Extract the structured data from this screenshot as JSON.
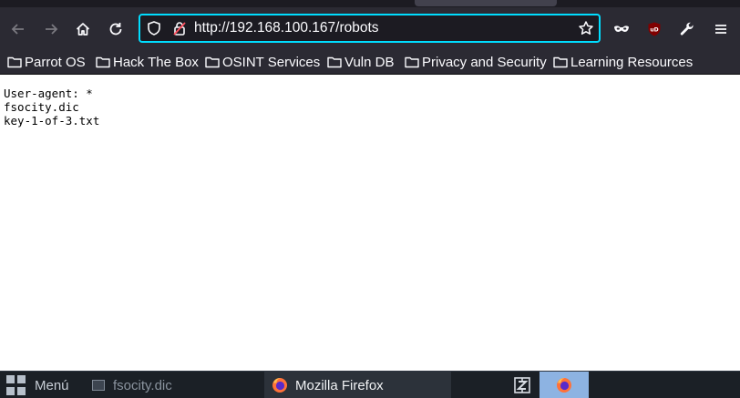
{
  "browser": {
    "url": "http://192.168.100.167/robots"
  },
  "bookmarks": [
    {
      "label": "Parrot OS"
    },
    {
      "label": "Hack The Box"
    },
    {
      "label": "OSINT Services"
    },
    {
      "label": "Vuln DB"
    },
    {
      "label": "Privacy and Security"
    },
    {
      "label": "Learning Resources"
    }
  ],
  "page": {
    "lines": [
      "User-agent: *",
      "fsocity.dic",
      "key-1-of-3.txt"
    ]
  },
  "taskbar": {
    "menu_label": "Menú",
    "terminal_label": "fsocity.dic",
    "firefox_label": "Mozilla Firefox"
  },
  "icons": {
    "back": "arrow-left-icon",
    "forward": "arrow-right-icon",
    "home": "home-icon",
    "reload": "reload-icon",
    "tracking": "shield-icon",
    "insecure": "lock-slash-icon",
    "bookmark_star": "star-icon",
    "private_mask": "mask-icon",
    "ublock": "ublock-origin-icon",
    "tools": "wrench-icon",
    "menu": "hamburger-menu-icon",
    "folder": "folder-icon"
  },
  "colors": {
    "toolbar_bg": "#2b2a33",
    "urlbar_focus": "#00ddff",
    "taskbar_bg": "#1b2026",
    "ublock_red": "#800000"
  }
}
